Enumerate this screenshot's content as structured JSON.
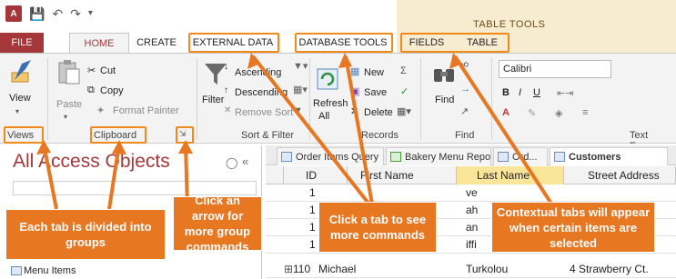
{
  "title_bar": {
    "app_icon_text": "A",
    "table_tools_label": "TABLE TOOLS"
  },
  "tabs": {
    "file": "FILE",
    "home": "HOME",
    "create": "CREATE",
    "external_data": "EXTERNAL DATA",
    "database_tools": "DATABASE TOOLS",
    "fields": "FIELDS",
    "table": "TABLE"
  },
  "ribbon": {
    "views": {
      "view": "View",
      "label": "Views"
    },
    "clipboard": {
      "paste": "Paste",
      "cut": "Cut",
      "copy": "Copy",
      "format_painter": "Format Painter",
      "label": "Clipboard"
    },
    "sort_filter": {
      "filter": "Filter",
      "ascending": "Ascending",
      "descending": "Descending",
      "remove_sort": "Remove Sort",
      "label": "Sort & Filter"
    },
    "records": {
      "refresh": "Refresh",
      "refresh_sub": "All",
      "new": "New",
      "save": "Save",
      "delete": "Delete",
      "label": "Records"
    },
    "find": {
      "find": "Find",
      "label": "Find"
    },
    "text_formatting": {
      "font": "Calibri",
      "label": "Text Forma"
    }
  },
  "nav_pane": {
    "title": "All Access Objects",
    "item": "Menu Items",
    "collapse_glyph": "«"
  },
  "doc_tabs": [
    {
      "label": "Order Items Query"
    },
    {
      "label": "Bakery Menu Report"
    },
    {
      "label": "Ord..."
    },
    {
      "label": "Customers"
    }
  ],
  "grid": {
    "headers": [
      "ID",
      "First Name",
      "Last Name",
      "Street Address"
    ],
    "rows": [
      [
        "1",
        "",
        "ve",
        ""
      ],
      [
        "1",
        "",
        "ah",
        ""
      ],
      [
        "1",
        "",
        "an",
        ""
      ],
      [
        "1",
        "",
        "iffi",
        ""
      ],
      [
        "110",
        "Michael",
        "Turkolou",
        "4 Strawberry Ct."
      ]
    ]
  },
  "callouts": {
    "groups": "Each tab is divided into groups",
    "arrow": "Click an arrow for more group commands",
    "tab": "Click a tab to see more commands",
    "contextual": "Contextual tabs will appear when certain items are selected"
  },
  "colors": {
    "accent": "#a4373a",
    "callout": "#e87722",
    "highlight_box": "#f28a1b",
    "table_tools_bg": "#f7ecd0"
  }
}
